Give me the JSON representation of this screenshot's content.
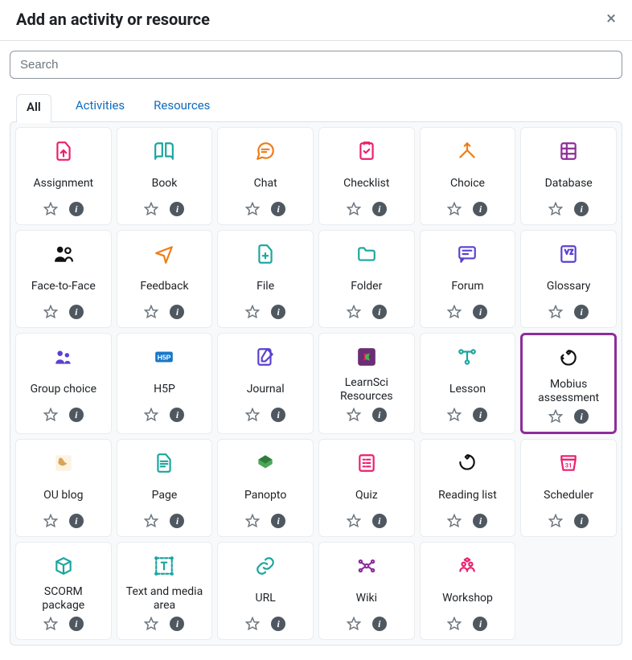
{
  "dialog": {
    "title": "Add an activity or resource"
  },
  "search": {
    "placeholder": "Search",
    "value": ""
  },
  "tabs": [
    {
      "id": "all",
      "label": "All",
      "active": true
    },
    {
      "id": "activities",
      "label": "Activities",
      "active": false
    },
    {
      "id": "resources",
      "label": "Resources",
      "active": false
    }
  ],
  "items": [
    {
      "id": "assignment",
      "label": "Assignment",
      "icon": "assignment",
      "color": "#eb1e6e",
      "highlight": false
    },
    {
      "id": "book",
      "label": "Book",
      "icon": "book",
      "color": "#1aa59f",
      "highlight": false
    },
    {
      "id": "chat",
      "label": "Chat",
      "icon": "chat",
      "color": "#f07c13",
      "highlight": false
    },
    {
      "id": "checklist",
      "label": "Checklist",
      "icon": "checklist",
      "color": "#eb1e6e",
      "highlight": false
    },
    {
      "id": "choice",
      "label": "Choice",
      "icon": "choice",
      "color": "#f07c13",
      "highlight": false
    },
    {
      "id": "database",
      "label": "Database",
      "icon": "database",
      "color": "#8e2d9a",
      "highlight": false
    },
    {
      "id": "facetoface",
      "label": "Face-to-Face",
      "icon": "facetoface",
      "color": "#111111",
      "highlight": false
    },
    {
      "id": "feedback",
      "label": "Feedback",
      "icon": "feedback",
      "color": "#f07c13",
      "highlight": false
    },
    {
      "id": "file",
      "label": "File",
      "icon": "file",
      "color": "#1aa59f",
      "highlight": false
    },
    {
      "id": "folder",
      "label": "Folder",
      "icon": "folder",
      "color": "#1aa59f",
      "highlight": false
    },
    {
      "id": "forum",
      "label": "Forum",
      "icon": "forum",
      "color": "#5b40d1",
      "highlight": false
    },
    {
      "id": "glossary",
      "label": "Glossary",
      "icon": "glossary",
      "color": "#5b40d1",
      "highlight": false
    },
    {
      "id": "groupchoice",
      "label": "Group choice",
      "icon": "groupchoice",
      "color": "#5b40d1",
      "highlight": false
    },
    {
      "id": "h5p",
      "label": "H5P",
      "icon": "h5p",
      "color": "#1877c9",
      "highlight": false
    },
    {
      "id": "journal",
      "label": "Journal",
      "icon": "journal",
      "color": "#5b40d1",
      "highlight": false
    },
    {
      "id": "learnsci",
      "label": "LearnSci Resources",
      "icon": "learnsci",
      "color": "#6b2d73",
      "highlight": false
    },
    {
      "id": "lesson",
      "label": "Lesson",
      "icon": "lesson",
      "color": "#1aa59f",
      "highlight": false
    },
    {
      "id": "mobius",
      "label": "Mobius assessment",
      "icon": "mobius",
      "color": "#111111",
      "highlight": true
    },
    {
      "id": "oublog",
      "label": "OU blog",
      "icon": "oublog",
      "color": "#d8a35a",
      "highlight": false
    },
    {
      "id": "page",
      "label": "Page",
      "icon": "page",
      "color": "#1aa59f",
      "highlight": false
    },
    {
      "id": "panopto",
      "label": "Panopto",
      "icon": "panopto",
      "color": "#2f7d3a",
      "highlight": false
    },
    {
      "id": "quiz",
      "label": "Quiz",
      "icon": "quiz",
      "color": "#eb1e6e",
      "highlight": false
    },
    {
      "id": "readinglist",
      "label": "Reading list",
      "icon": "readinglist",
      "color": "#111111",
      "highlight": false
    },
    {
      "id": "scheduler",
      "label": "Scheduler",
      "icon": "scheduler",
      "color": "#eb1e6e",
      "highlight": false
    },
    {
      "id": "scorm",
      "label": "SCORM package",
      "icon": "scorm",
      "color": "#1aa59f",
      "highlight": false
    },
    {
      "id": "textmedia",
      "label": "Text and media area",
      "icon": "textmedia",
      "color": "#1aa59f",
      "highlight": false
    },
    {
      "id": "url",
      "label": "URL",
      "icon": "url",
      "color": "#1aa59f",
      "highlight": false
    },
    {
      "id": "wiki",
      "label": "Wiki",
      "icon": "wiki",
      "color": "#8e2d9a",
      "highlight": false
    },
    {
      "id": "workshop",
      "label": "Workshop",
      "icon": "workshop",
      "color": "#eb1e6e",
      "highlight": false
    }
  ]
}
